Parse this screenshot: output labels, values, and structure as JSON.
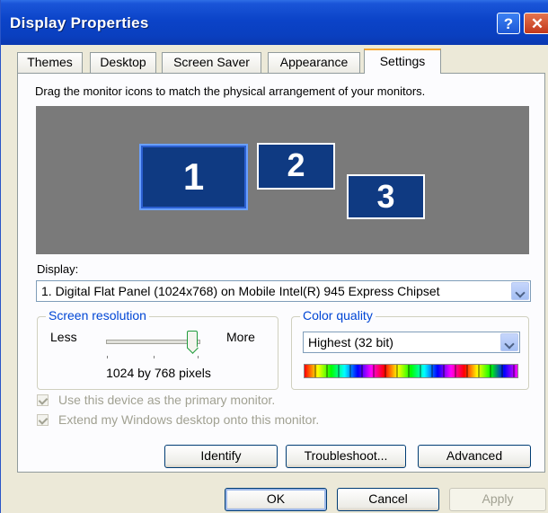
{
  "window": {
    "title": "Display Properties"
  },
  "titlebar": {
    "help_label": "?",
    "close_label": "✕"
  },
  "tabs": [
    {
      "label": "Themes"
    },
    {
      "label": "Desktop"
    },
    {
      "label": "Screen Saver"
    },
    {
      "label": "Appearance"
    },
    {
      "label": "Settings",
      "active": true
    }
  ],
  "settings": {
    "instruction": "Drag the monitor icons to match the physical arrangement of your monitors.",
    "monitors": [
      {
        "number": "1",
        "selected": true
      },
      {
        "number": "2"
      },
      {
        "number": "3"
      }
    ],
    "display_label": "Display:",
    "display_value": "1. Digital Flat Panel (1024x768) on Mobile Intel(R) 945 Express Chipset",
    "resolution": {
      "title": "Screen resolution",
      "less_label": "Less",
      "more_label": "More",
      "value": "1024 by 768 pixels",
      "slider_level_fraction": 1.0
    },
    "color_quality": {
      "title": "Color quality",
      "value": "Highest (32 bit)"
    },
    "checkboxes": [
      {
        "label": "Use this device as the primary monitor.",
        "checked": true,
        "disabled": true
      },
      {
        "label": "Extend my Windows desktop onto this monitor.",
        "checked": true,
        "disabled": true
      }
    ],
    "buttons": {
      "identify": "Identify",
      "troubleshoot": "Troubleshoot...",
      "advanced": "Advanced"
    }
  },
  "dialog_buttons": {
    "ok": "OK",
    "cancel": "Cancel",
    "apply": "Apply"
  },
  "colors": {
    "titlebar": "#0b43c8",
    "dialog_bg": "#ece9d8",
    "monitor_area": "#7a7a7a",
    "monitor": "#0f3a82",
    "group_title": "#0046d5"
  }
}
